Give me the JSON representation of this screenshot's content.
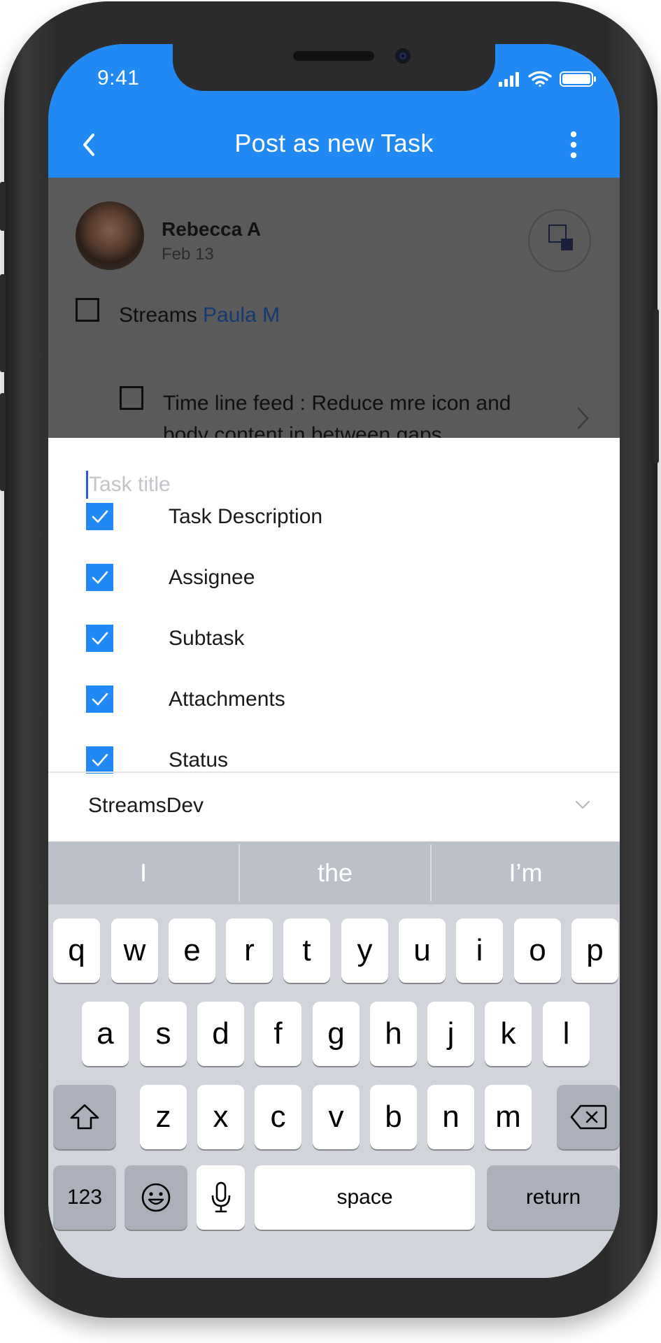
{
  "status_bar": {
    "time": "9:41"
  },
  "header": {
    "title": "Post as new Task",
    "back_icon": "chevron-left-icon",
    "menu_icon": "more-vertical-icon",
    "background_color": "#2189F3"
  },
  "post": {
    "author": "Rebecca A",
    "date": "Feb 13",
    "line1_text": "Streams",
    "line1_mention": "Paula M",
    "line2_text": "Time line feed : Reduce mre icon and body content in between gaps"
  },
  "task_form": {
    "title_placeholder": "Task title",
    "title_value": "",
    "options": [
      {
        "label": "Task Description",
        "checked": true
      },
      {
        "label": "Assignee",
        "checked": true
      },
      {
        "label": "Subtask",
        "checked": true
      },
      {
        "label": "Attachments",
        "checked": true
      },
      {
        "label": "Status",
        "checked": true
      }
    ],
    "stream": "StreamsDev"
  },
  "keyboard": {
    "suggestions": [
      "I",
      "the",
      "I’m"
    ],
    "row1": [
      "q",
      "w",
      "e",
      "r",
      "t",
      "y",
      "u",
      "i",
      "o",
      "p"
    ],
    "row2": [
      "a",
      "s",
      "d",
      "f",
      "g",
      "h",
      "j",
      "k",
      "l"
    ],
    "row3": [
      "z",
      "x",
      "c",
      "v",
      "b",
      "n",
      "m"
    ],
    "numbers_label": "123",
    "space_label": "space",
    "return_label": "return"
  }
}
